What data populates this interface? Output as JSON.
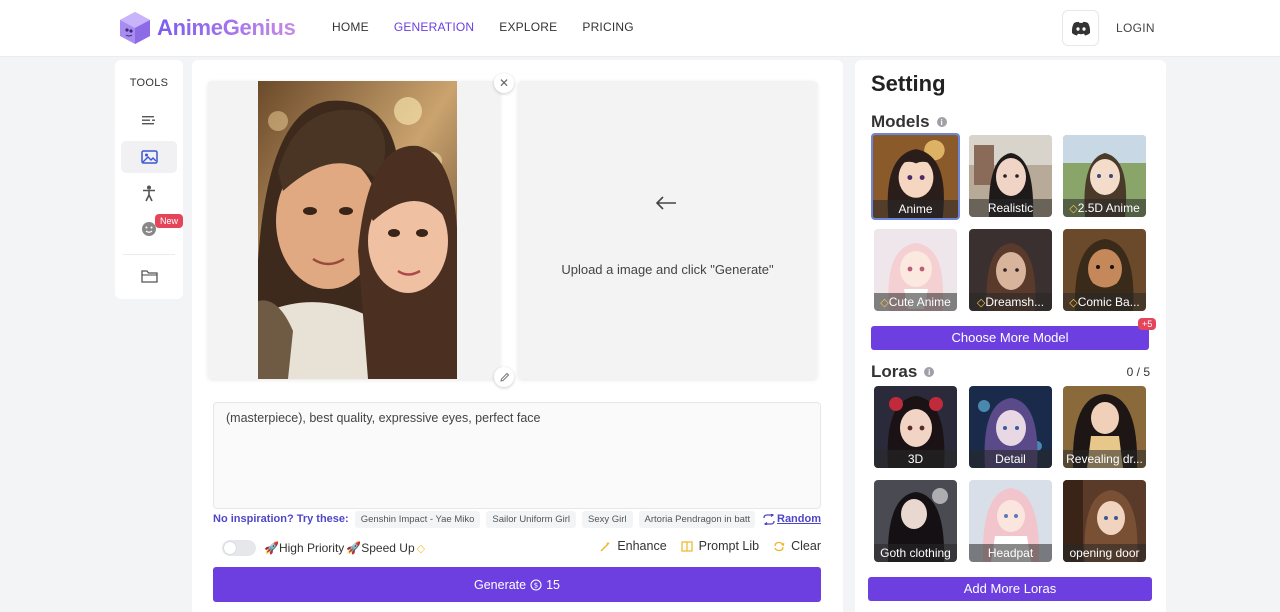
{
  "header": {
    "logo_text": "AnimeGenius",
    "nav": [
      {
        "label": "HOME",
        "active": false
      },
      {
        "label": "GENERATION",
        "active": true
      },
      {
        "label": "EXPLORE",
        "active": false
      },
      {
        "label": "PRICING",
        "active": false
      }
    ],
    "login_label": "LOGIN"
  },
  "tools": {
    "title": "TOOLS",
    "badge_new": "New"
  },
  "upload": {
    "text": "Upload a image and click \"Generate\""
  },
  "prompt": {
    "value": "(masterpiece), best quality, expressive eyes, perfect face"
  },
  "inspiration": {
    "label": "No inspiration? Try these:",
    "chips": [
      "Genshin Impact - Yae Miko",
      "Sailor Uniform Girl",
      "Sexy Girl",
      "Artoria Pendragon in batt"
    ],
    "random_label": "Random"
  },
  "options": {
    "high_priority": "🚀High Priority",
    "speed_up": "🚀Speed Up"
  },
  "actions": {
    "enhance": "Enhance",
    "prompt_lib": "Prompt Lib",
    "clear": "Clear"
  },
  "generate": {
    "label": "Generate",
    "cost": "15"
  },
  "settings": {
    "title": "Setting",
    "models_title": "Models",
    "models": [
      {
        "label": "Anime",
        "premium": false
      },
      {
        "label": "Realistic",
        "premium": false
      },
      {
        "label": "2.5D Anime",
        "premium": true
      },
      {
        "label": "Cute Anime",
        "premium": true
      },
      {
        "label": "Dreamsh...",
        "premium": true
      },
      {
        "label": "Comic Ba...",
        "premium": true
      }
    ],
    "choose_more": "Choose More Model",
    "more_badge": "+5",
    "loras_title": "Loras",
    "loras_count": "0 / 5",
    "loras": [
      {
        "label": "3D"
      },
      {
        "label": "Detail"
      },
      {
        "label": "Revealing dr..."
      },
      {
        "label": "Goth clothing"
      },
      {
        "label": "Headpat"
      },
      {
        "label": "opening door"
      }
    ],
    "add_loras": "Add More Loras"
  },
  "colors": {
    "accent": "#6d3fe0",
    "link": "#4f46c8",
    "badge": "#e5455a"
  }
}
